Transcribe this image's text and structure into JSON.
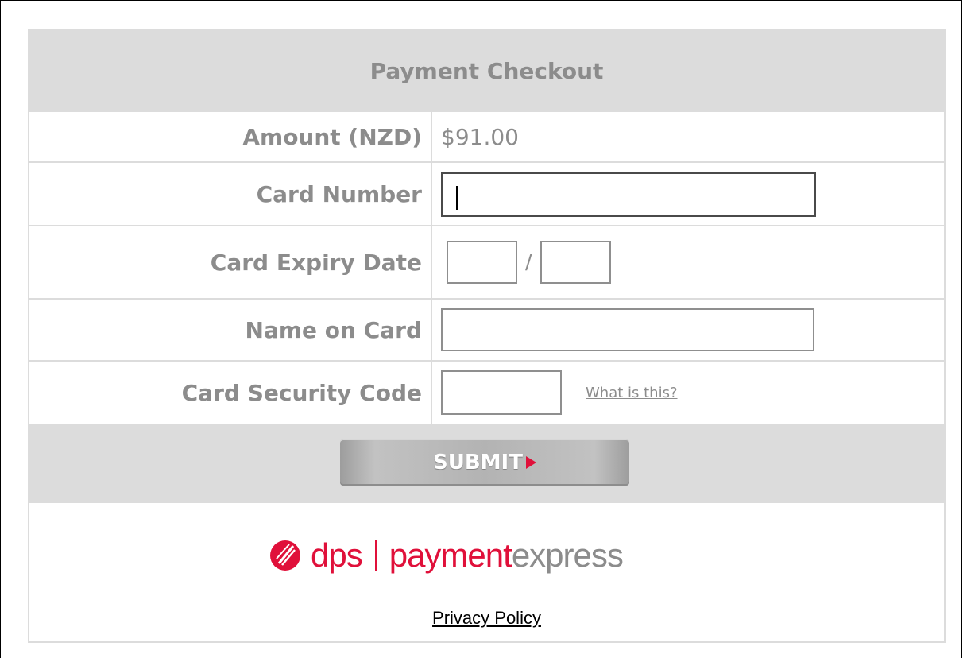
{
  "form": {
    "title": "Payment Checkout",
    "amount_label": "Amount (NZD)",
    "amount_value": "$91.00",
    "card_number_label": "Card Number",
    "card_number_value": "",
    "expiry_label": "Card Expiry Date",
    "expiry_month_value": "",
    "expiry_separator": "/",
    "expiry_year_value": "",
    "name_label": "Name on Card",
    "name_value": "",
    "security_label": "Card Security Code",
    "security_value": "",
    "security_help_link": "What is this?",
    "submit_label": "SUBMIT"
  },
  "footer": {
    "logo_dps": "dps",
    "logo_payment": "payment",
    "logo_express": "express",
    "privacy_link": "Privacy Policy"
  },
  "colors": {
    "brand_red": "#e0103a",
    "label_gray": "#8c8c8c",
    "panel_gray": "#dcdcdc"
  },
  "icons": {
    "submit_arrow": "play-arrow-icon",
    "dps_logo": "dps-logo-icon"
  }
}
